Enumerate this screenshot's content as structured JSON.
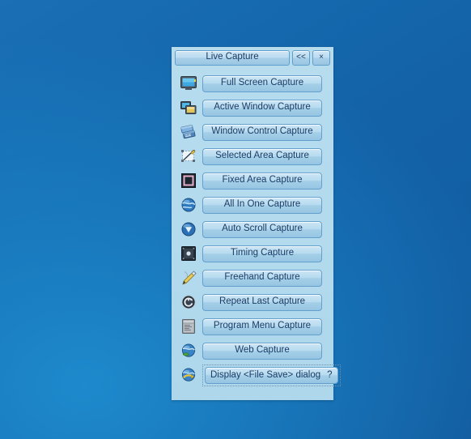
{
  "window": {
    "title": "Live Capture",
    "collapse_label": "<<",
    "close_label": "×",
    "accent_color": "#1b3c66",
    "panel_color": "#b3daed",
    "desktop_color": "#1466ad"
  },
  "rows": [
    {
      "label": "Full Screen Capture",
      "icon": "monitor-icon"
    },
    {
      "label": "Active Window Capture",
      "icon": "windows-overlap-icon"
    },
    {
      "label": "Window Control Capture",
      "icon": "window-controls-icon"
    },
    {
      "label": "Selected Area Capture",
      "icon": "pencil-selection-icon"
    },
    {
      "label": "Fixed Area Capture",
      "icon": "fixed-square-icon"
    },
    {
      "label": "All In One Capture",
      "icon": "globe-icon"
    },
    {
      "label": "Auto Scroll Capture",
      "icon": "scroll-down-sphere-icon"
    },
    {
      "label": "Timing Capture",
      "icon": "timer-film-icon"
    },
    {
      "label": "Freehand Capture",
      "icon": "freehand-pen-icon"
    },
    {
      "label": "Repeat Last Capture",
      "icon": "repeat-circle-icon"
    },
    {
      "label": "Program Menu Capture",
      "icon": "program-window-icon"
    },
    {
      "label": "Web Capture",
      "icon": "globe-green-icon"
    }
  ],
  "dialog_row": {
    "label": "Display <File Save> dialog",
    "help_label": "?",
    "icon": "globe-save-icon"
  }
}
